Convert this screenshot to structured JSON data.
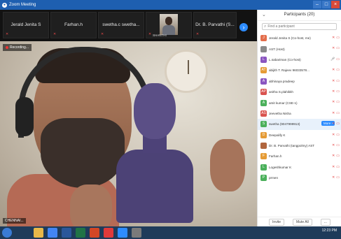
{
  "window": {
    "title": "Zoom Meeting",
    "buttons": {
      "minimize": "–",
      "maximize": "□",
      "close": "×"
    }
  },
  "thumbnails": [
    {
      "name": "Jerald Jenita S",
      "muted": true
    },
    {
      "name": "Farhan.h",
      "muted": true
    },
    {
      "name": "swetha.c swetha...",
      "muted": true
    },
    {
      "name": "",
      "caption": "SHANTHI",
      "is_photo": true,
      "muted": true
    },
    {
      "name": "Dr. B. Parvathi (S...",
      "muted": true
    }
  ],
  "strip_next": "›",
  "main_video": {
    "recording_label": "Recording...",
    "speaker_name": "CHENNAI..."
  },
  "participants_panel": {
    "title": "Participants (20)",
    "collapse_icon": "chevron-down-icon",
    "search_placeholder": "Find a participant",
    "participants": [
      {
        "initial": "J",
        "color": "#e36d4b",
        "name": "Jerald Jenita S (Co-host, me)",
        "mic": "muted",
        "cam": "off"
      },
      {
        "initial": "",
        "color": "#8a8a8a",
        "name": "AST (Host)",
        "mic": "muted",
        "cam": "off"
      },
      {
        "initial": "L",
        "color": "#8a55c0",
        "name": "L.sabariman (Co-host)",
        "mic": "on",
        "cam": "on"
      },
      {
        "initial": "AT",
        "color": "#e59b35",
        "name": "abijith T. Rajeev 96033578...",
        "mic": "muted",
        "cam": "off"
      },
      {
        "initial": "A",
        "color": "#8a55c0",
        "name": "abhinaya pradeep",
        "mic": "muted",
        "cam": "off"
      },
      {
        "initial": "AP",
        "color": "#d9534f",
        "name": "anitha S.plahikkh",
        "mic": "muted",
        "cam": "off"
      },
      {
        "initial": "A",
        "color": "#4bb05b",
        "name": "amit kumar (CSE-1)",
        "mic": "muted",
        "cam": "off"
      },
      {
        "initial": "AS",
        "color": "#d9534f",
        "name": "Jeevetha Nisha",
        "mic": "muted",
        "cam": "off"
      },
      {
        "initial": "S",
        "color": "#4bb05b",
        "name": "swetha (9047999913)",
        "mic": "muted",
        "cam": "off",
        "highlight": true,
        "more": "More ›"
      },
      {
        "initial": "D",
        "color": "#e59b35",
        "name": "Deepalify K",
        "mic": "muted",
        "cam": "off"
      },
      {
        "initial": "",
        "color": "#b0663e",
        "name": "Dr. B. Parvathi (tangpolmy) AST",
        "mic": "muted",
        "cam": "off"
      },
      {
        "initial": "F",
        "color": "#e59b35",
        "name": "Farhan.h",
        "mic": "muted",
        "cam": "off"
      },
      {
        "initial": "L",
        "color": "#4bb05b",
        "name": "Logeshkumar K",
        "mic": "muted",
        "cam": "off"
      },
      {
        "initial": "P",
        "color": "#4bb05b",
        "name": "prmen",
        "mic": "muted",
        "cam": "off"
      }
    ],
    "footer": {
      "invite": "Invite",
      "mute_all": "Mute All",
      "more": "..."
    }
  },
  "taskbar": {
    "clock_time": "12:23 PM",
    "clock_date": "",
    "icons": [
      "start",
      "file-explorer",
      "chrome",
      "word",
      "excel",
      "powerpoint",
      "acrobat",
      "zoom",
      "settings"
    ]
  }
}
